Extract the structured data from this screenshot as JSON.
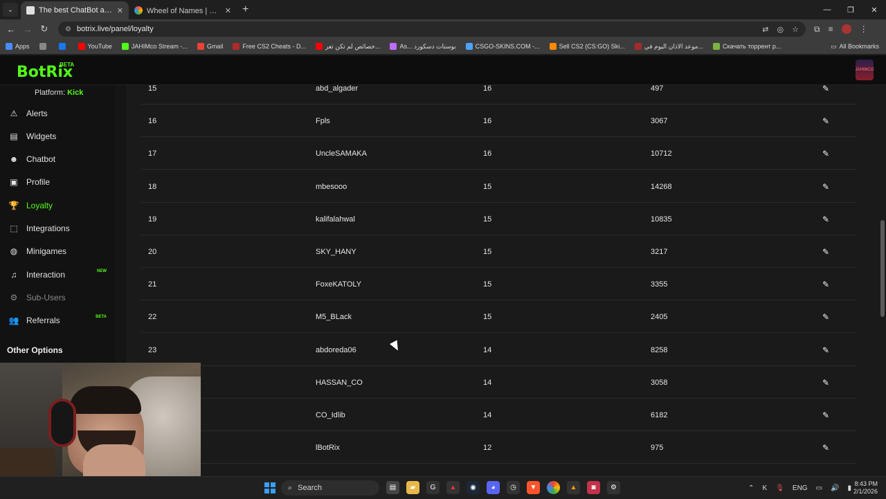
{
  "browser": {
    "tabs": [
      {
        "title": "The best ChatBot and Widgets",
        "favicon_color": "#e0e0e0",
        "active": true
      },
      {
        "title": "Wheel of Names | اسم العشوائي",
        "favicon_color": "#ffb400",
        "active": false
      }
    ],
    "new_tab_symbol": "+",
    "url": "botrix.live/panel/loyalty",
    "bookmarks": [
      {
        "label": "Apps",
        "color": "#4a8cff"
      },
      {
        "label": "",
        "color": "#888888"
      },
      {
        "label": "",
        "color": "#1877f2"
      },
      {
        "label": "YouTube",
        "color": "#ff0000"
      },
      {
        "label": "JAHIMco Stream -...",
        "color": "#53fc18"
      },
      {
        "label": "Gmail",
        "color": "#ea4335"
      },
      {
        "label": "Free CS2 Cheats - D...",
        "color": "#b02a2a"
      },
      {
        "label": "خصائص لم تكن تعر...",
        "color": "#ff0000"
      },
      {
        "label": "As... بوستات دسكورد",
        "color": "#c06bff"
      },
      {
        "label": "CSGO-SKINS.COM -...",
        "color": "#4aa3ff"
      },
      {
        "label": "Sell CS2 (CS:GO) Ski...",
        "color": "#ff8a00"
      },
      {
        "label": "موعد الاذان اليوم في...",
        "color": "#a52a2a"
      },
      {
        "label": "Скачать торрент p...",
        "color": "#7cb342"
      }
    ],
    "all_bookmarks": "All Bookmarks"
  },
  "app": {
    "logo": "BotRix",
    "logo_badge": "BETA",
    "avatar_text": "JAHIMCO",
    "platform_label": "Platform:",
    "platform_value": "Kick"
  },
  "sidebar": {
    "items": [
      {
        "label": "Alerts",
        "icon": "⚠",
        "icon_name": "alert-icon"
      },
      {
        "label": "Widgets",
        "icon": "▤",
        "icon_name": "widgets-icon"
      },
      {
        "label": "Chatbot",
        "icon": "☻",
        "icon_name": "robot-icon"
      },
      {
        "label": "Profile",
        "icon": "▣",
        "icon_name": "profile-card-icon"
      },
      {
        "label": "Loyalty",
        "icon": "🏆",
        "icon_name": "trophy-icon"
      },
      {
        "label": "Integrations",
        "icon": "⬚",
        "icon_name": "integrations-icon"
      },
      {
        "label": "Minigames",
        "icon": "◍",
        "icon_name": "gamepad-icon"
      },
      {
        "label": "Interaction",
        "icon": "♫",
        "icon_name": "music-icon"
      },
      {
        "label": "Sub-Users",
        "icon": "⚙",
        "icon_name": "sub-users-icon"
      },
      {
        "label": "Referrals",
        "icon": "👥",
        "icon_name": "users-icon"
      }
    ],
    "badges": {
      "interaction": "NEW",
      "referrals": "BETA"
    },
    "other_options": "Other Options"
  },
  "loyalty_table": {
    "edit_icon": "✎",
    "rows": [
      {
        "rank": "15",
        "name": "abd_algader",
        "level": "16",
        "points": "497"
      },
      {
        "rank": "16",
        "name": "Fpls",
        "level": "16",
        "points": "3067"
      },
      {
        "rank": "17",
        "name": "UncleSAMAKA",
        "level": "16",
        "points": "10712"
      },
      {
        "rank": "18",
        "name": "mbesooo",
        "level": "15",
        "points": "14268"
      },
      {
        "rank": "19",
        "name": "kalifalahwal",
        "level": "15",
        "points": "10835"
      },
      {
        "rank": "20",
        "name": "SKY_HANY",
        "level": "15",
        "points": "3217"
      },
      {
        "rank": "21",
        "name": "FoxeKATOLY",
        "level": "15",
        "points": "3355"
      },
      {
        "rank": "22",
        "name": "M5_BLack",
        "level": "15",
        "points": "2405"
      },
      {
        "rank": "23",
        "name": "abdoreda06",
        "level": "14",
        "points": "8258"
      },
      {
        "rank": "",
        "name": "HASSAN_CO",
        "level": "14",
        "points": "3058"
      },
      {
        "rank": "",
        "name": "CO_Idlib",
        "level": "14",
        "points": "6182"
      },
      {
        "rank": "",
        "name": "lBotRix",
        "level": "12",
        "points": "975"
      }
    ]
  },
  "taskbar": {
    "search_placeholder": "Search",
    "language": "ENG",
    "time": "8:43 PM",
    "date": "2/1/2026"
  }
}
